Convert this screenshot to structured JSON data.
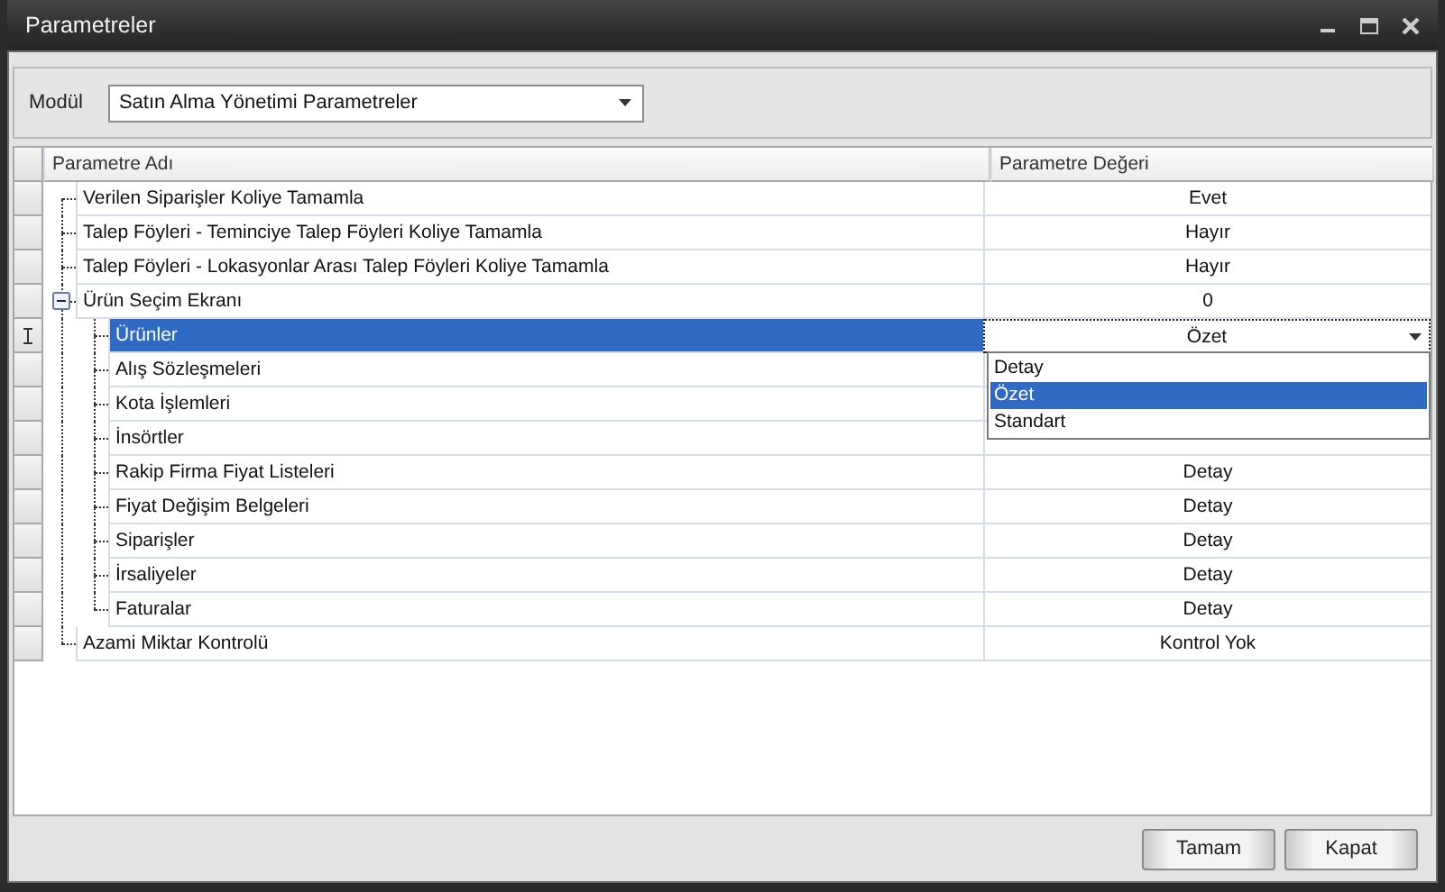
{
  "window": {
    "title": "Parametreler"
  },
  "module": {
    "label": "Modül",
    "value": "Satın Alma Yönetimi Parametreler"
  },
  "grid": {
    "columns": [
      "Parametre Adı",
      "Parametre Değeri"
    ],
    "rows": [
      {
        "name": "Verilen Siparişler Koliye Tamamla",
        "value": "Evet",
        "selected": false,
        "editing": false
      },
      {
        "name": "Talep Föyleri - Teminciye Talep Föyleri Koliye Tamamla",
        "value": "Hayır",
        "selected": false,
        "editing": false
      },
      {
        "name": "Talep Föyleri - Lokasyonlar Arası Talep Föyleri Koliye Tamamla",
        "value": "Hayır",
        "selected": false,
        "editing": false
      },
      {
        "name": "Ürün Seçim Ekranı",
        "value": "0",
        "selected": false,
        "editing": false,
        "expanded": true,
        "children": [
          {
            "name": "Ürünler",
            "value": "Özet",
            "selected": true,
            "editing": true
          },
          {
            "name": "Alış Sözleşmeleri",
            "selected": false,
            "editing": false
          },
          {
            "name": "Kota İşlemleri",
            "selected": false,
            "editing": false
          },
          {
            "name": "İnsörtler",
            "selected": false,
            "editing": false
          },
          {
            "name": "Rakip Firma Fiyat Listeleri",
            "value": "Detay",
            "selected": false,
            "editing": false
          },
          {
            "name": "Fiyat Değişim Belgeleri",
            "value": "Detay",
            "selected": false,
            "editing": false
          },
          {
            "name": "Siparişler",
            "value": "Detay",
            "selected": false,
            "editing": false
          },
          {
            "name": "İrsaliyeler",
            "value": "Detay",
            "selected": false,
            "editing": false
          },
          {
            "name": "Faturalar",
            "value": "Detay",
            "selected": false,
            "editing": false
          }
        ]
      },
      {
        "name": "Azami Miktar Kontrolü",
        "value": "Kontrol Yok",
        "selected": false,
        "editing": false
      }
    ],
    "dropdown": {
      "options": [
        {
          "label": "Detay",
          "selected": false
        },
        {
          "label": "Özet",
          "selected": true
        },
        {
          "label": "Standart",
          "selected": false
        }
      ]
    }
  },
  "buttons": [
    "Tamam",
    "Kapat"
  ]
}
